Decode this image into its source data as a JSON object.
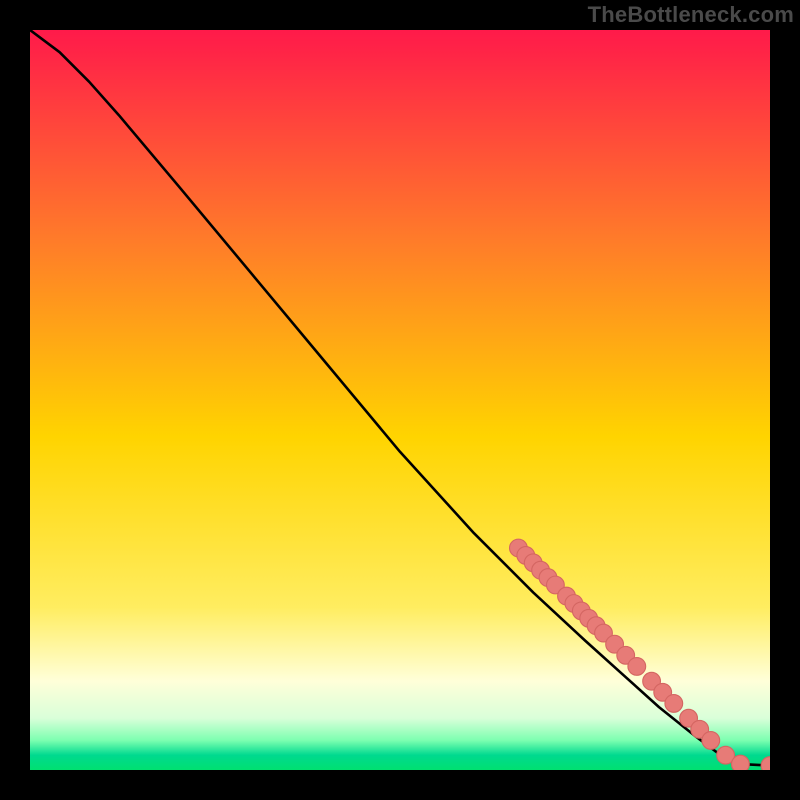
{
  "watermark": "TheBottleneck.com",
  "colors": {
    "top": "#ff1a4a",
    "mid_upper": "#ff7a2a",
    "mid": "#ffd400",
    "yellow": "#ffed60",
    "pale_yellow": "#ffffd9",
    "pale_green": "#d9ffd9",
    "green_band": "#7cffb0",
    "teal": "#00d98f",
    "green_bottom": "#00e070",
    "curve": "#000000",
    "marker_fill": "#e77b77",
    "marker_stroke": "#d46662"
  },
  "chart_data": {
    "type": "line",
    "title": "",
    "xlabel": "",
    "ylabel": "",
    "xlim": [
      0,
      100
    ],
    "ylim": [
      0,
      100
    ],
    "curve": [
      {
        "x": 0,
        "y": 100
      },
      {
        "x": 4,
        "y": 97
      },
      {
        "x": 8,
        "y": 93
      },
      {
        "x": 12,
        "y": 88.5
      },
      {
        "x": 20,
        "y": 79
      },
      {
        "x": 30,
        "y": 67
      },
      {
        "x": 40,
        "y": 55
      },
      {
        "x": 50,
        "y": 43
      },
      {
        "x": 60,
        "y": 32
      },
      {
        "x": 68,
        "y": 24
      },
      {
        "x": 75,
        "y": 17.5
      },
      {
        "x": 80,
        "y": 13
      },
      {
        "x": 85,
        "y": 8.5
      },
      {
        "x": 90,
        "y": 4.5
      },
      {
        "x": 94,
        "y": 1.5
      },
      {
        "x": 96,
        "y": 0.8
      },
      {
        "x": 100,
        "y": 0.6
      }
    ],
    "markers": [
      {
        "x": 66,
        "y": 30
      },
      {
        "x": 67,
        "y": 29
      },
      {
        "x": 68,
        "y": 28
      },
      {
        "x": 69,
        "y": 27
      },
      {
        "x": 70,
        "y": 26
      },
      {
        "x": 71,
        "y": 25
      },
      {
        "x": 72.5,
        "y": 23.5
      },
      {
        "x": 73.5,
        "y": 22.5
      },
      {
        "x": 74.5,
        "y": 21.5
      },
      {
        "x": 75.5,
        "y": 20.5
      },
      {
        "x": 76.5,
        "y": 19.5
      },
      {
        "x": 77.5,
        "y": 18.5
      },
      {
        "x": 79,
        "y": 17
      },
      {
        "x": 80.5,
        "y": 15.5
      },
      {
        "x": 82,
        "y": 14
      },
      {
        "x": 84,
        "y": 12
      },
      {
        "x": 85.5,
        "y": 10.5
      },
      {
        "x": 87,
        "y": 9
      },
      {
        "x": 89,
        "y": 7
      },
      {
        "x": 90.5,
        "y": 5.5
      },
      {
        "x": 92,
        "y": 4
      },
      {
        "x": 94,
        "y": 2
      },
      {
        "x": 96,
        "y": 0.8
      },
      {
        "x": 100,
        "y": 0.6
      }
    ],
    "marker_radius": 1.2
  }
}
